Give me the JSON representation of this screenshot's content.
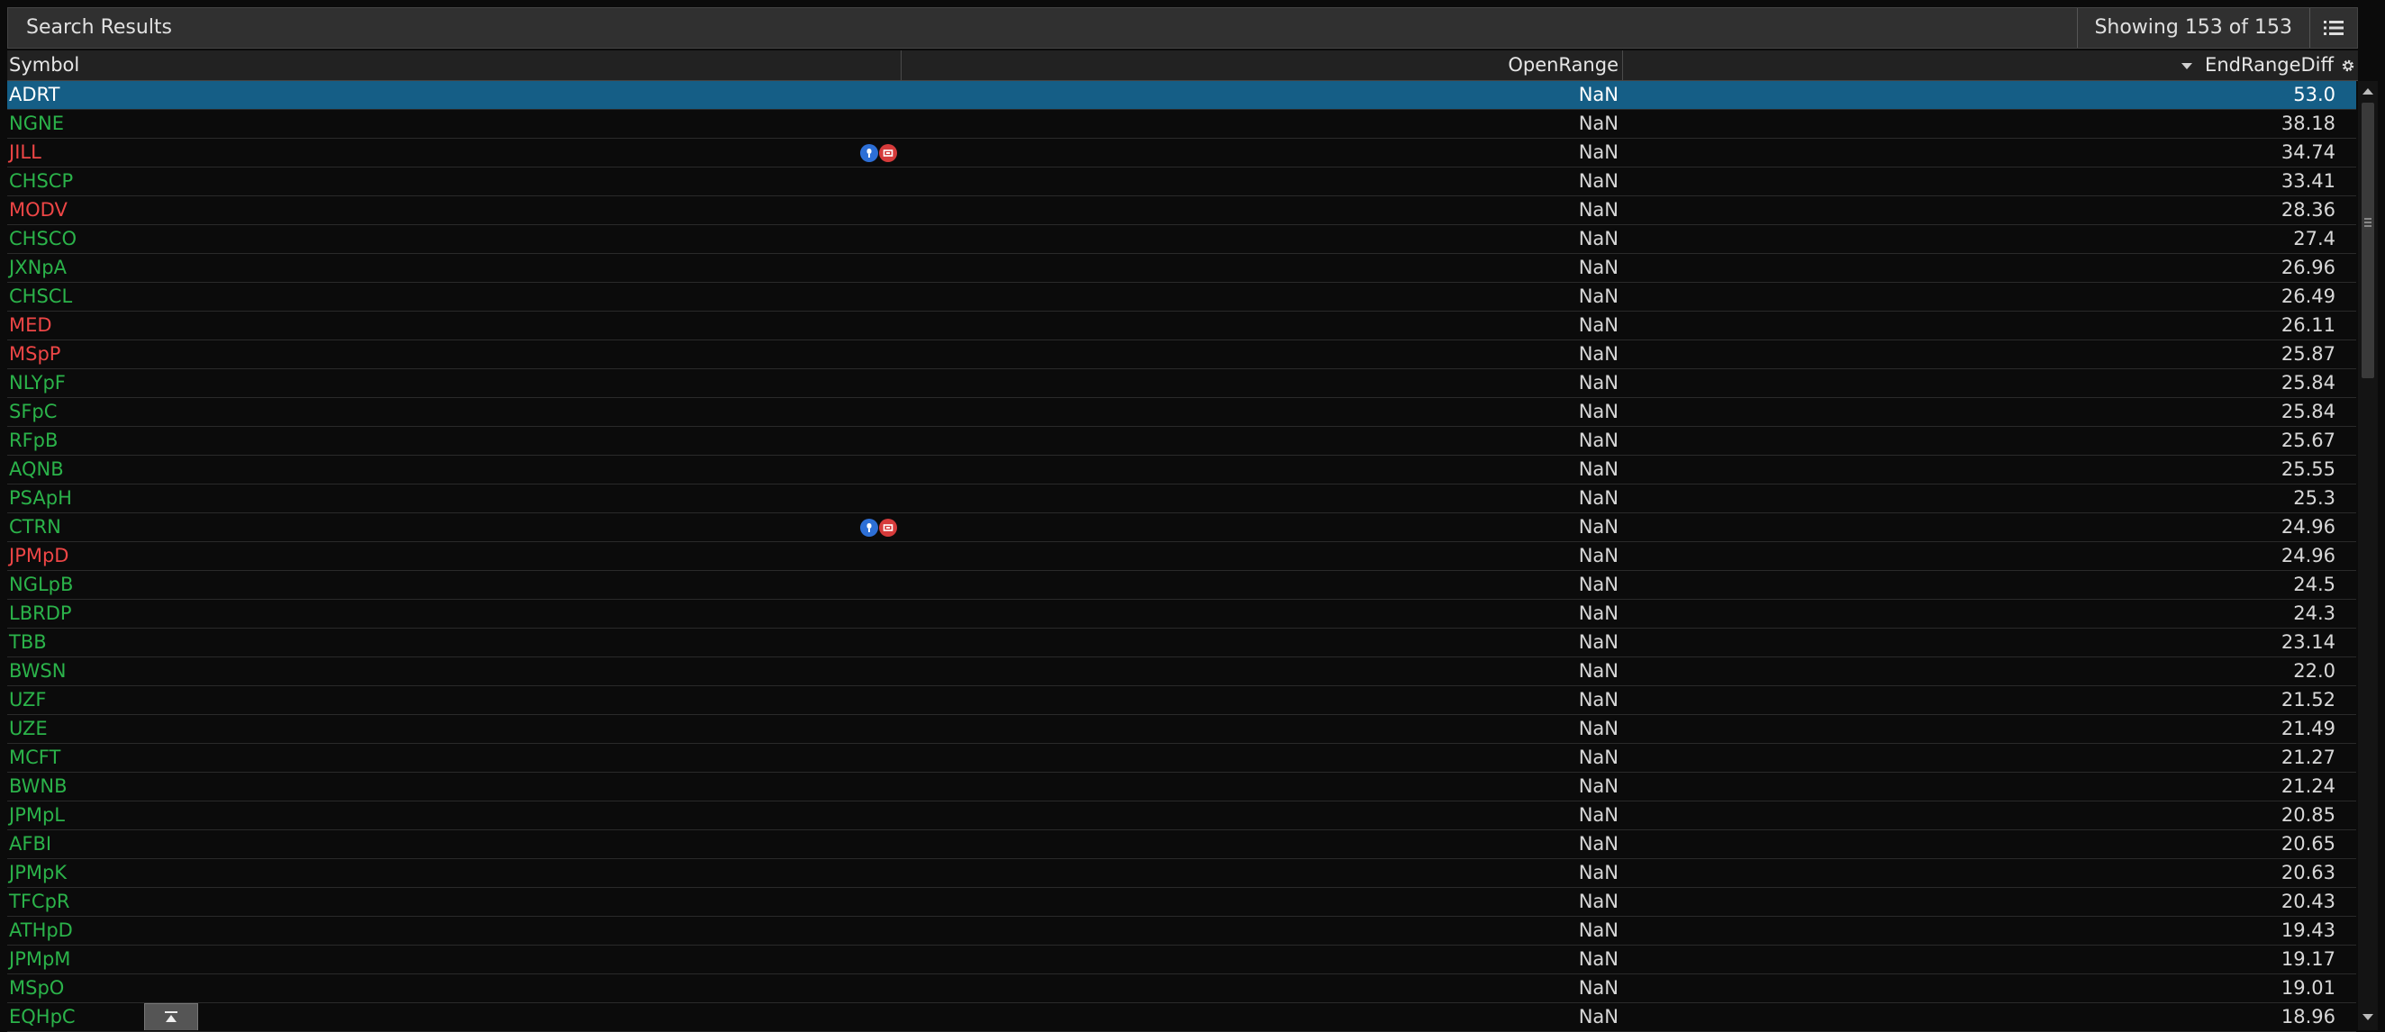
{
  "header": {
    "title": "Search Results",
    "showing": "Showing 153 of 153"
  },
  "columns": {
    "symbol": "Symbol",
    "open_range": "OpenRange",
    "end_range_diff": "EndRangeDiff"
  },
  "colors": {
    "up": "#2bb34a",
    "down": "#ee4646",
    "selected_row": "#155e86"
  },
  "rows": [
    {
      "symbol": "ADRT",
      "color": "green",
      "open": "NaN",
      "end": "53.0",
      "selected": true,
      "icons": false
    },
    {
      "symbol": "NGNE",
      "color": "green",
      "open": "NaN",
      "end": "38.18",
      "selected": false,
      "icons": false
    },
    {
      "symbol": "JILL",
      "color": "red",
      "open": "NaN",
      "end": "34.74",
      "selected": false,
      "icons": true
    },
    {
      "symbol": "CHSCP",
      "color": "green",
      "open": "NaN",
      "end": "33.41",
      "selected": false,
      "icons": false
    },
    {
      "symbol": "MODV",
      "color": "red",
      "open": "NaN",
      "end": "28.36",
      "selected": false,
      "icons": false
    },
    {
      "symbol": "CHSCO",
      "color": "green",
      "open": "NaN",
      "end": "27.4",
      "selected": false,
      "icons": false
    },
    {
      "symbol": "JXNpA",
      "color": "green",
      "open": "NaN",
      "end": "26.96",
      "selected": false,
      "icons": false
    },
    {
      "symbol": "CHSCL",
      "color": "green",
      "open": "NaN",
      "end": "26.49",
      "selected": false,
      "icons": false
    },
    {
      "symbol": "MED",
      "color": "red",
      "open": "NaN",
      "end": "26.11",
      "selected": false,
      "icons": false
    },
    {
      "symbol": "MSpP",
      "color": "red",
      "open": "NaN",
      "end": "25.87",
      "selected": false,
      "icons": false
    },
    {
      "symbol": "NLYpF",
      "color": "green",
      "open": "NaN",
      "end": "25.84",
      "selected": false,
      "icons": false
    },
    {
      "symbol": "SFpC",
      "color": "green",
      "open": "NaN",
      "end": "25.84",
      "selected": false,
      "icons": false
    },
    {
      "symbol": "RFpB",
      "color": "green",
      "open": "NaN",
      "end": "25.67",
      "selected": false,
      "icons": false
    },
    {
      "symbol": "AQNB",
      "color": "green",
      "open": "NaN",
      "end": "25.55",
      "selected": false,
      "icons": false
    },
    {
      "symbol": "PSApH",
      "color": "green",
      "open": "NaN",
      "end": "25.3",
      "selected": false,
      "icons": false
    },
    {
      "symbol": "CTRN",
      "color": "green",
      "open": "NaN",
      "end": "24.96",
      "selected": false,
      "icons": true
    },
    {
      "symbol": "JPMpD",
      "color": "red",
      "open": "NaN",
      "end": "24.96",
      "selected": false,
      "icons": false
    },
    {
      "symbol": "NGLpB",
      "color": "green",
      "open": "NaN",
      "end": "24.5",
      "selected": false,
      "icons": false
    },
    {
      "symbol": "LBRDP",
      "color": "green",
      "open": "NaN",
      "end": "24.3",
      "selected": false,
      "icons": false
    },
    {
      "symbol": "TBB",
      "color": "green",
      "open": "NaN",
      "end": "23.14",
      "selected": false,
      "icons": false
    },
    {
      "symbol": "BWSN",
      "color": "green",
      "open": "NaN",
      "end": "22.0",
      "selected": false,
      "icons": false
    },
    {
      "symbol": "UZF",
      "color": "green",
      "open": "NaN",
      "end": "21.52",
      "selected": false,
      "icons": false
    },
    {
      "symbol": "UZE",
      "color": "green",
      "open": "NaN",
      "end": "21.49",
      "selected": false,
      "icons": false
    },
    {
      "symbol": "MCFT",
      "color": "green",
      "open": "NaN",
      "end": "21.27",
      "selected": false,
      "icons": false
    },
    {
      "symbol": "BWNB",
      "color": "green",
      "open": "NaN",
      "end": "21.24",
      "selected": false,
      "icons": false
    },
    {
      "symbol": "JPMpL",
      "color": "green",
      "open": "NaN",
      "end": "20.85",
      "selected": false,
      "icons": false
    },
    {
      "symbol": "AFBI",
      "color": "green",
      "open": "NaN",
      "end": "20.65",
      "selected": false,
      "icons": false
    },
    {
      "symbol": "JPMpK",
      "color": "green",
      "open": "NaN",
      "end": "20.63",
      "selected": false,
      "icons": false
    },
    {
      "symbol": "TFCpR",
      "color": "green",
      "open": "NaN",
      "end": "20.43",
      "selected": false,
      "icons": false
    },
    {
      "symbol": "ATHpD",
      "color": "green",
      "open": "NaN",
      "end": "19.43",
      "selected": false,
      "icons": false
    },
    {
      "symbol": "JPMpM",
      "color": "green",
      "open": "NaN",
      "end": "19.17",
      "selected": false,
      "icons": false
    },
    {
      "symbol": "MSpO",
      "color": "green",
      "open": "NaN",
      "end": "19.01",
      "selected": false,
      "icons": false
    },
    {
      "symbol": "EQHpC",
      "color": "green",
      "open": "NaN",
      "end": "18.96",
      "selected": false,
      "icons": false
    }
  ],
  "icons": {
    "menu": "list-menu-icon",
    "settings": "gear-icon",
    "sort": "sort-descending-icon",
    "row_icon_1": "earnings-icon",
    "row_icon_2": "dividend-icon",
    "scroll_top": "scroll-to-top-icon"
  }
}
